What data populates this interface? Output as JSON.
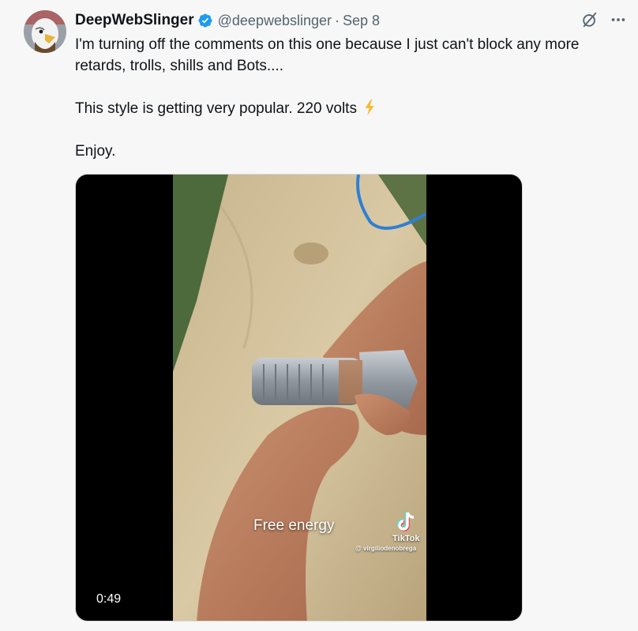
{
  "author": {
    "display_name": "DeepWebSlinger",
    "handle": "@deepwebslinger",
    "separator": "·",
    "date": "Sep 8",
    "verified_color": "#1d9bf0"
  },
  "tweet": {
    "paragraphs": [
      "I'm turning off the comments on this one because I just can't block any more retards, trolls, shills and Bots....",
      "This style is getting very popular. 220 volts",
      "Enjoy."
    ],
    "emoji_icon": "high-voltage-icon"
  },
  "media": {
    "overlay_caption": "Free energy",
    "watermark_brand": "TikTok",
    "watermark_user": "@ virgiliodenobrega",
    "duration": "0:49"
  },
  "icons": {
    "grok": "grok-slash-icon",
    "more": "more-horizontal-icon"
  }
}
